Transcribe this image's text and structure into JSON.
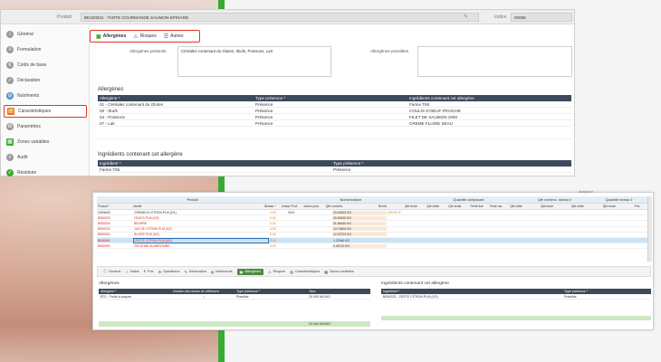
{
  "window": {
    "product_label": "Produit",
    "product_value": "BE100031 - TARTE GOURMANDE SAUMON-EPINARD",
    "indice_label": "Indice",
    "indice_value": "00005"
  },
  "sidebar": {
    "items": [
      {
        "label": "Général",
        "icon": "info-icon",
        "color": "#8a8a8a"
      },
      {
        "label": "Formulation",
        "icon": "formula-icon",
        "color": "#8a8a8a"
      },
      {
        "label": "Coûts de base",
        "icon": "cost-icon",
        "color": "#8a8a8a"
      },
      {
        "label": "Déclaration",
        "icon": "declaration-icon",
        "color": "#8a8a8a"
      },
      {
        "label": "Nutriments",
        "icon": "nutrients-icon",
        "color": "#4a8bc4"
      },
      {
        "label": "Caractéristiques",
        "icon": "characteristics-icon",
        "color": "#e07b1a"
      },
      {
        "label": "Paramètres",
        "icon": "settings-icon",
        "color": "#8a8a8a"
      },
      {
        "label": "Zones variables",
        "icon": "zones-icon",
        "color": "#39a935"
      },
      {
        "label": "Audit",
        "icon": "audit-icon",
        "color": "#8a8a8a"
      },
      {
        "label": "Résiduire",
        "icon": "reduce-icon",
        "color": "#39a935"
      }
    ]
  },
  "tabs": [
    {
      "label": "Allergènes",
      "icon": "allergen-icon"
    },
    {
      "label": "Risques",
      "icon": "warning-icon"
    },
    {
      "label": "Autres",
      "icon": "list-icon"
    }
  ],
  "form": {
    "allergenes_presents_label": "Allergènes présents",
    "allergenes_presents_value": "Céréales contenant du Gluten, Œufs, Poissons, Lait",
    "allergenes_possibles_label": "Allergènes possibles",
    "allergenes_possibles_value": ""
  },
  "allergenes_grid": {
    "title": "Allergènes",
    "headers": [
      "Allergène *",
      "Type présence *",
      "Ingrédients contenant cet allergène"
    ],
    "rows": [
      [
        "01 - Céréales contenant du Gluten",
        "Présence",
        "Farine T65"
      ],
      [
        "03 - Œufs",
        "Présence",
        "COULIS D'OEUF FRAICHE"
      ],
      [
        "04 - Poissons",
        "Présence",
        "FILET DE SAUMON 1000"
      ],
      [
        "07 - Lait",
        "Présence",
        "CREME FLUIDE SEAU"
      ]
    ]
  },
  "ingredients_grid": {
    "title": "Ingrédients contenant cet allergène",
    "headers": [
      "Ingrédient *",
      "Type présence *"
    ],
    "rows": [
      [
        "Farine T65",
        "Présence"
      ]
    ]
  },
  "overlay": {
    "corner_label": "Analyseur",
    "group_headers": [
      "Produit",
      "Nomenclature",
      "Quantité composant",
      "Qté nomenc. niveau 0",
      "Quantité niveau 0"
    ],
    "col_headers": [
      "Produit *",
      "Libellé",
      "Niveau *",
      "Indice PLM",
      "Indice prev.",
      "Qté nomenc.",
      "Remb.",
      "Qté brute",
      "Qté nette",
      "Qté brute",
      "Perte fixe",
      "Perte var.",
      "Qté nette",
      "Qté brute",
      "Qté nette",
      "Qté brute",
      "Prix"
    ],
    "rows": [
      {
        "code": "D305630",
        "label": "CREMEUX CITRON PLM (0/1)",
        "lvl": "0.00",
        "ind": "0001",
        "style": "normal",
        "q": "20.00000 KG",
        "r": "100.00 %"
      },
      {
        "code": "B050000",
        "label": "OEUFS PLM (0/2)",
        "lvl": "0.00",
        "ind": "",
        "style": "red",
        "q": "20.00000 KG",
        "r": ""
      },
      {
        "code": "B050030",
        "label": "BEURRE",
        "lvl": "0.00",
        "ind": "",
        "style": "red",
        "q": "31.84640 KG",
        "r": ""
      },
      {
        "code": "B050033",
        "label": "JUS DE CITRON PLM (0/2)",
        "lvl": "0.00",
        "ind": "",
        "style": "red",
        "q": "13.74600 KG",
        "r": ""
      },
      {
        "code": "B050050",
        "label": "SUCRE PLM (0/2)",
        "lvl": "0.00",
        "ind": "",
        "style": "red",
        "q": "12.22722 KG",
        "r": ""
      },
      {
        "code": "B050051",
        "label": "ZESTE CITRON PLM (0/2)",
        "lvl": "0.00",
        "ind": "",
        "style": "sel",
        "q": "1.37460 KG",
        "r": ""
      },
      {
        "code": "B050090",
        "label": "GELATINE ALIMENTAIRE",
        "lvl": "0.00",
        "ind": "",
        "style": "red",
        "q": "0.40710 KG",
        "r": ""
      }
    ],
    "tabs": [
      "Général",
      "Valide",
      "Prix",
      "Opérations",
      "Déclaration",
      "Nutriments",
      "Allergènes",
      "Risques",
      "Caractéristiques",
      "Zones variables"
    ],
    "left_title": "Allergènes",
    "left_headers": [
      "Allergène *",
      "Gestion des doses de référence",
      "Type présence *",
      "Taux"
    ],
    "left_rows": [
      [
        "B70 - Fruits à coques",
        "",
        "Possible",
        "20.000 MG/KG"
      ]
    ],
    "left_total": "20.000 MG/KG",
    "right_title": "Ingrédients contenant cet allergène",
    "right_headers": [
      "Ingrédient *",
      "Type présence *"
    ],
    "right_rows": [
      [
        "B050033 - ZESTE CITRON PLM (0/2)",
        "Possible"
      ]
    ]
  }
}
